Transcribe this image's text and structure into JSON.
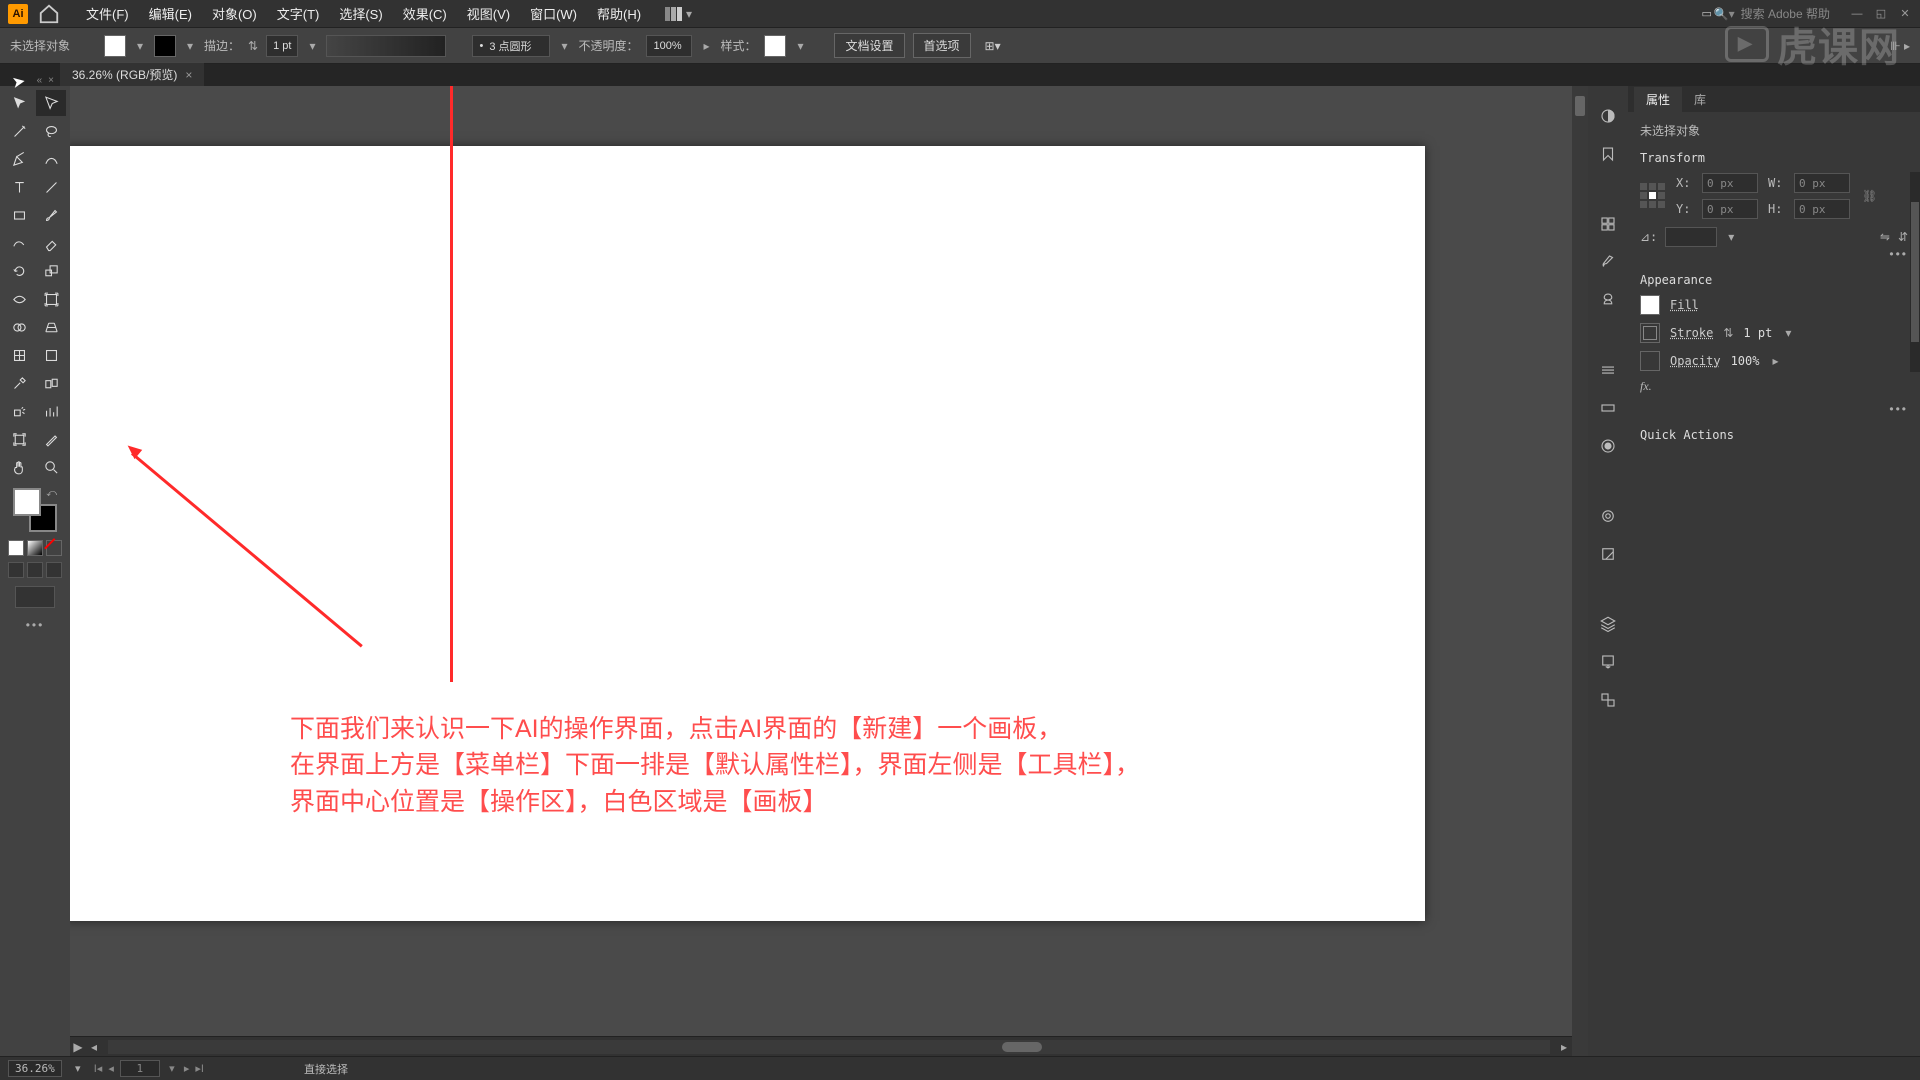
{
  "app": {
    "logo": "Ai",
    "search_placeholder": "搜索 Adobe 帮助"
  },
  "menu": {
    "file": "文件(F)",
    "edit": "编辑(E)",
    "object": "对象(O)",
    "type": "文字(T)",
    "select": "选择(S)",
    "effect": "效果(C)",
    "view": "视图(V)",
    "window": "窗口(W)",
    "help": "帮助(H)"
  },
  "propbar": {
    "no_sel": "未选择对象",
    "stroke_lbl": "描边：",
    "stroke_w": "1 pt",
    "dash": "3 点圆形",
    "opacity_lbl": "不透明度：",
    "opacity": "100%",
    "style_lbl": "样式：",
    "doc_setup": "文档设置",
    "prefs": "首选项"
  },
  "doc": {
    "tab": "36.26% (RGB/预览)",
    "close": "×"
  },
  "annot": {
    "l1": "下面我们来认识一下AI的操作界面，点击AI界面的【新建】一个画板，",
    "l2": "在界面上方是【菜单栏】下面一排是【默认属性栏】，界面左侧是【工具栏】，",
    "l3": "界面中心位置是【操作区】，白色区域是【画板】"
  },
  "panel": {
    "tab_props": "属性",
    "tab_lib": "库",
    "no_sel": "未选择对象",
    "transform": "Transform",
    "x": "X:",
    "y": "Y:",
    "w": "W:",
    "h": "H:",
    "xv": "0 px",
    "yv": "0 px",
    "wv": "0 px",
    "hv": "0 px",
    "angle": "⊿:",
    "appearance": "Appearance",
    "fill": "Fill",
    "stroke": "Stroke",
    "stroke_v": "1 pt",
    "opacity": "Opacity",
    "opacity_v": "100%",
    "fx": "fx.",
    "quick": "Quick Actions"
  },
  "status": {
    "zoom": "36.26%",
    "artboard": "1",
    "tool_hint": "直接选择"
  },
  "watermark": "虎课网"
}
